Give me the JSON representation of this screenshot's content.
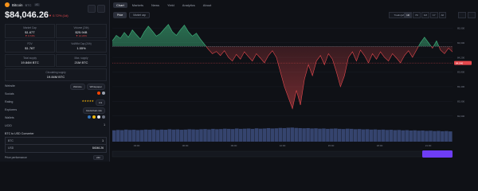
{
  "coin": {
    "name": "Bitcoin",
    "symbol": "BTC",
    "rank": "#1",
    "price": "$84,046.26",
    "change": "▼ 0.72% (1d)"
  },
  "stats": [
    {
      "label": "Market Cap",
      "value": "$1.67T",
      "sub": "▼ 0.72%"
    },
    {
      "label": "Volume (24h)",
      "value": "$25.94B",
      "sub": "▼ 14.22%"
    },
    {
      "label": "FDV",
      "value": "$1.76T",
      "sub": ""
    },
    {
      "label": "Vol/Mkt Cap (24h)",
      "value": "1.55%",
      "sub": ""
    },
    {
      "label": "Total supply",
      "value": "19.84M BTC",
      "sub": ""
    },
    {
      "label": "Max. supply",
      "value": "21M BTC",
      "sub": ""
    },
    {
      "label": "Circulating supply",
      "value": "19.84M BTC",
      "sub": ""
    }
  ],
  "info": {
    "website_label": "Website",
    "website_chips": [
      "Website",
      "Whitepaper"
    ],
    "socials_label": "Socials",
    "rating_label": "Rating",
    "rating_value": "4.9",
    "explorers_label": "Explorers",
    "explorers_value": "blockchain.info",
    "wallets_label": "Wallets",
    "ucid_label": "UCID",
    "ucid_value": "1"
  },
  "converter": {
    "title": "BTC to USD Converter",
    "from_label": "BTC",
    "from_value": "1",
    "to_label": "USD",
    "to_value": "84046.26"
  },
  "footer": {
    "label": "Price performance",
    "button": "24h"
  },
  "tabs": [
    "Chart",
    "Markets",
    "News",
    "Yield",
    "Analytics",
    "About"
  ],
  "active_tab": "Chart",
  "subtabs": [
    "Price",
    "Market cap"
  ],
  "active_subtab": "Price",
  "ranges": [
    "1D",
    "7D",
    "1M",
    "1Y",
    "All"
  ],
  "active_range": "1D",
  "dropdown": "TradingView",
  "chart_data": {
    "type": "area",
    "baseline": 84500,
    "ylim": [
      82400,
      85200
    ],
    "y_ticks": [
      "85,000",
      "84,600",
      "84,200",
      "83,800",
      "83,400",
      "83,000",
      "82,600"
    ],
    "x_ticks": [
      "03:00",
      "06:00",
      "09:00",
      "12:00",
      "15:00",
      "18:00",
      "21:00"
    ],
    "values": [
      84650,
      84800,
      84720,
      84880,
      84750,
      84950,
      84820,
      84700,
      84900,
      85050,
      84920,
      84780,
      84850,
      84980,
      85100,
      84900,
      84800,
      84950,
      85080,
      84900,
      84780,
      84860,
      84700,
      84560,
      84420,
      84300,
      84360,
      84250,
      84380,
      84200,
      84100,
      84280,
      84150,
      84350,
      84220,
      84100,
      84300,
      84180,
      84050,
      84250,
      84380,
      84200,
      83800,
      83400,
      83100,
      82800,
      83300,
      82900,
      83600,
      84000,
      83700,
      84100,
      84250,
      84000,
      84300,
      84150,
      83800,
      83400,
      83700,
      84200,
      84350,
      84100,
      84400,
      84250,
      84050,
      84300,
      84150,
      84350,
      84200,
      84100,
      84300,
      84180,
      84050,
      84250,
      84380,
      84200,
      84400,
      84600,
      84750,
      84600,
      84450,
      84650,
      84400,
      84300,
      84450,
      84350
    ],
    "volume": [
      0.62,
      0.64,
      0.63,
      0.66,
      0.64,
      0.65,
      0.63,
      0.64,
      0.66,
      0.65,
      0.67,
      0.64,
      0.66,
      0.65,
      0.68,
      0.66,
      0.67,
      0.65,
      0.66,
      0.68,
      0.67,
      0.66,
      0.68,
      0.69,
      0.67,
      0.7,
      0.68,
      0.69,
      0.71,
      0.7,
      0.69,
      0.72,
      0.7,
      0.71,
      0.72,
      0.7,
      0.73,
      0.71,
      0.72,
      0.74,
      0.72,
      0.73,
      0.75,
      0.74,
      0.76,
      0.77,
      0.75,
      0.74,
      0.73,
      0.74,
      0.72,
      0.73,
      0.71,
      0.72,
      0.7,
      0.71,
      0.72,
      0.7,
      0.69,
      0.71,
      0.7,
      0.68,
      0.69,
      0.67,
      0.68,
      0.66,
      0.67,
      0.65,
      0.66,
      0.64,
      0.65,
      0.63,
      0.64,
      0.62,
      0.63,
      0.61,
      0.62,
      0.6,
      0.61,
      0.59,
      0.6,
      0.58,
      0.59,
      0.57,
      0.58,
      0.56
    ],
    "current_price_label": "84,046",
    "colors": {
      "up": "#3fb87f",
      "down": "#e5484d",
      "volume": "#3a4a78",
      "baseline": "#6b7180"
    }
  }
}
